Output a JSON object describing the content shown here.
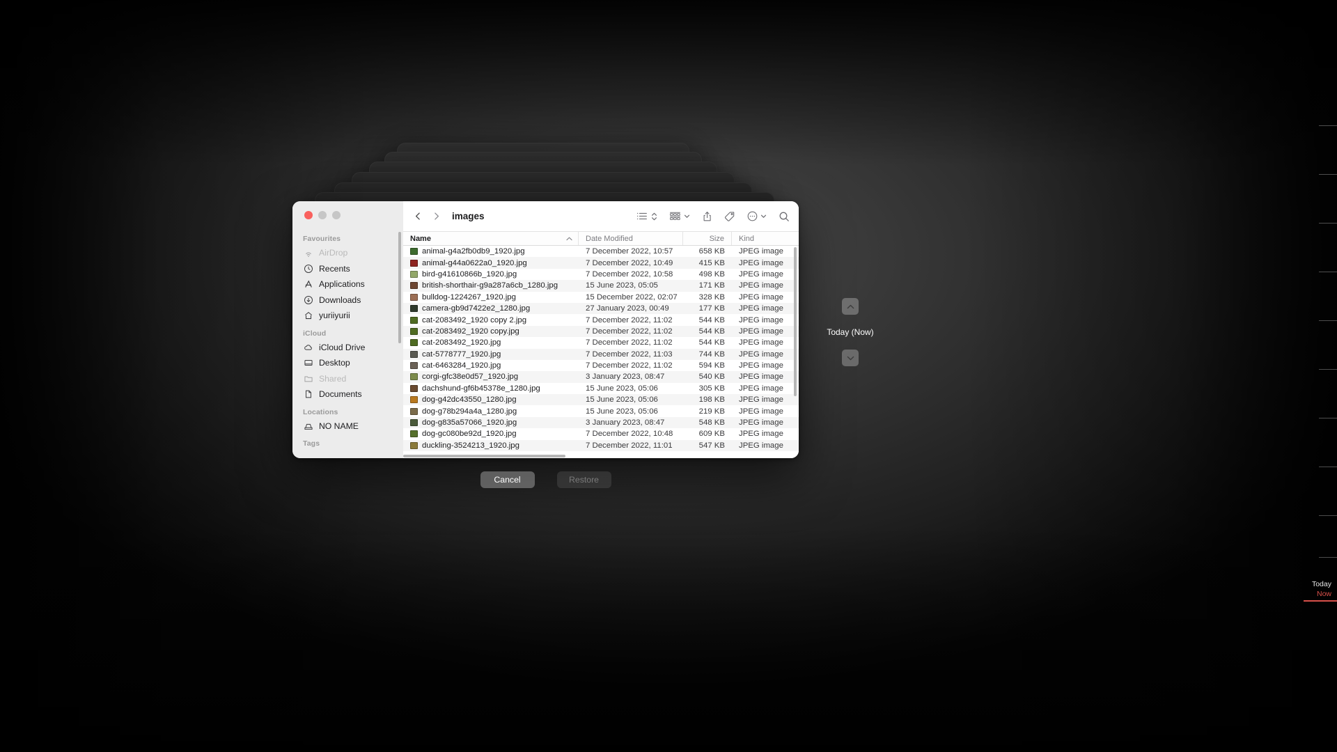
{
  "window": {
    "title": "images",
    "traffic_lights": [
      "close",
      "minimize",
      "zoom"
    ]
  },
  "sidebar": {
    "sections": [
      {
        "title": "Favourites",
        "items": [
          {
            "label": "AirDrop",
            "icon": "airdrop-icon",
            "dim": true
          },
          {
            "label": "Recents",
            "icon": "clock-icon",
            "dim": false
          },
          {
            "label": "Applications",
            "icon": "applications-icon",
            "dim": false
          },
          {
            "label": "Downloads",
            "icon": "download-icon",
            "dim": false
          },
          {
            "label": "yuriiyurii",
            "icon": "home-icon",
            "dim": false
          }
        ]
      },
      {
        "title": "iCloud",
        "items": [
          {
            "label": "iCloud Drive",
            "icon": "cloud-icon",
            "dim": false
          },
          {
            "label": "Desktop",
            "icon": "desktop-icon",
            "dim": false
          },
          {
            "label": "Shared",
            "icon": "folder-shared-icon",
            "dim": true
          },
          {
            "label": "Documents",
            "icon": "document-icon",
            "dim": false
          }
        ]
      },
      {
        "title": "Locations",
        "items": [
          {
            "label": "NO NAME",
            "icon": "external-drive-icon",
            "dim": false
          }
        ]
      },
      {
        "title": "Tags",
        "items": []
      }
    ]
  },
  "toolbar": {
    "back_label": "Back",
    "forward_label": "Forward",
    "view_list_label": "List view",
    "view_sort_label": "Sort order",
    "view_group_label": "Group items",
    "share_label": "Share",
    "tags_label": "Tags",
    "more_label": "More actions",
    "search_label": "Search"
  },
  "columns": [
    {
      "key": "name",
      "label": "Name",
      "sorted": true,
      "sort_dir": "asc"
    },
    {
      "key": "date",
      "label": "Date Modified",
      "sorted": false
    },
    {
      "key": "size",
      "label": "Size",
      "sorted": false
    },
    {
      "key": "kind",
      "label": "Kind",
      "sorted": false
    }
  ],
  "files": [
    {
      "name": "animal-g4a2fb0db9_1920.jpg",
      "date": "7 December 2022, 10:57",
      "size": "658 KB",
      "kind": "JPEG image",
      "thumb": "#3d6b2e"
    },
    {
      "name": "animal-g44a0622a0_1920.jpg",
      "date": "7 December 2022, 10:49",
      "size": "415 KB",
      "kind": "JPEG image",
      "thumb": "#8e2420"
    },
    {
      "name": "bird-g41610866b_1920.jpg",
      "date": "7 December 2022, 10:58",
      "size": "498 KB",
      "kind": "JPEG image",
      "thumb": "#93a86a"
    },
    {
      "name": "british-shorthair-g9a287a6cb_1280.jpg",
      "date": "15 June 2023, 05:05",
      "size": "171 KB",
      "kind": "JPEG image",
      "thumb": "#6d4631"
    },
    {
      "name": "bulldog-1224267_1920.jpg",
      "date": "15 December 2022, 02:07",
      "size": "328 KB",
      "kind": "JPEG image",
      "thumb": "#9c6e55"
    },
    {
      "name": "camera-gb9d7422e2_1280.jpg",
      "date": "27 January 2023, 00:49",
      "size": "177 KB",
      "kind": "JPEG image",
      "thumb": "#2f3a2c"
    },
    {
      "name": "cat-2083492_1920 copy 2.jpg",
      "date": "7 December 2022, 11:02",
      "size": "544 KB",
      "kind": "JPEG image",
      "thumb": "#4f6b22"
    },
    {
      "name": "cat-2083492_1920 copy.jpg",
      "date": "7 December 2022, 11:02",
      "size": "544 KB",
      "kind": "JPEG image",
      "thumb": "#4f6b22"
    },
    {
      "name": "cat-2083492_1920.jpg",
      "date": "7 December 2022, 11:02",
      "size": "544 KB",
      "kind": "JPEG image",
      "thumb": "#4f6b22"
    },
    {
      "name": "cat-5778777_1920.jpg",
      "date": "7 December 2022, 11:03",
      "size": "744 KB",
      "kind": "JPEG image",
      "thumb": "#5a5a52"
    },
    {
      "name": "cat-6463284_1920.jpg",
      "date": "7 December 2022, 11:02",
      "size": "594 KB",
      "kind": "JPEG image",
      "thumb": "#6b6257"
    },
    {
      "name": "corgi-gfc38e0d57_1920.jpg",
      "date": "3 January 2023, 08:47",
      "size": "540 KB",
      "kind": "JPEG image",
      "thumb": "#7d8c4d"
    },
    {
      "name": "dachshund-gf6b45378e_1280.jpg",
      "date": "15 June 2023, 05:06",
      "size": "305 KB",
      "kind": "JPEG image",
      "thumb": "#6a4a30"
    },
    {
      "name": "dog-g42dc43550_1280.jpg",
      "date": "15 June 2023, 05:06",
      "size": "198 KB",
      "kind": "JPEG image",
      "thumb": "#b8781f"
    },
    {
      "name": "dog-g78b294a4a_1280.jpg",
      "date": "15 June 2023, 05:06",
      "size": "219 KB",
      "kind": "JPEG image",
      "thumb": "#7a6a4a"
    },
    {
      "name": "dog-g835a57066_1920.jpg",
      "date": "3 January 2023, 08:47",
      "size": "548 KB",
      "kind": "JPEG image",
      "thumb": "#4a5a3a"
    },
    {
      "name": "dog-gc080be92d_1920.jpg",
      "date": "7 December 2022, 10:48",
      "size": "609 KB",
      "kind": "JPEG image",
      "thumb": "#56702c"
    },
    {
      "name": "duckling-3524213_1920.jpg",
      "date": "7 December 2022, 11:01",
      "size": "547 KB",
      "kind": "JPEG image",
      "thumb": "#8a7a3a"
    }
  ],
  "actions": {
    "cancel_label": "Cancel",
    "restore_label": "Restore",
    "restore_disabled": true
  },
  "time_machine": {
    "up_arrow_label": "Go back in time",
    "down_arrow_label": "Go forward in time",
    "current_date_label": "Today (Now)",
    "timeline": {
      "today_label": "Today",
      "now_label": "Now",
      "now_color": "#d9504a"
    }
  }
}
